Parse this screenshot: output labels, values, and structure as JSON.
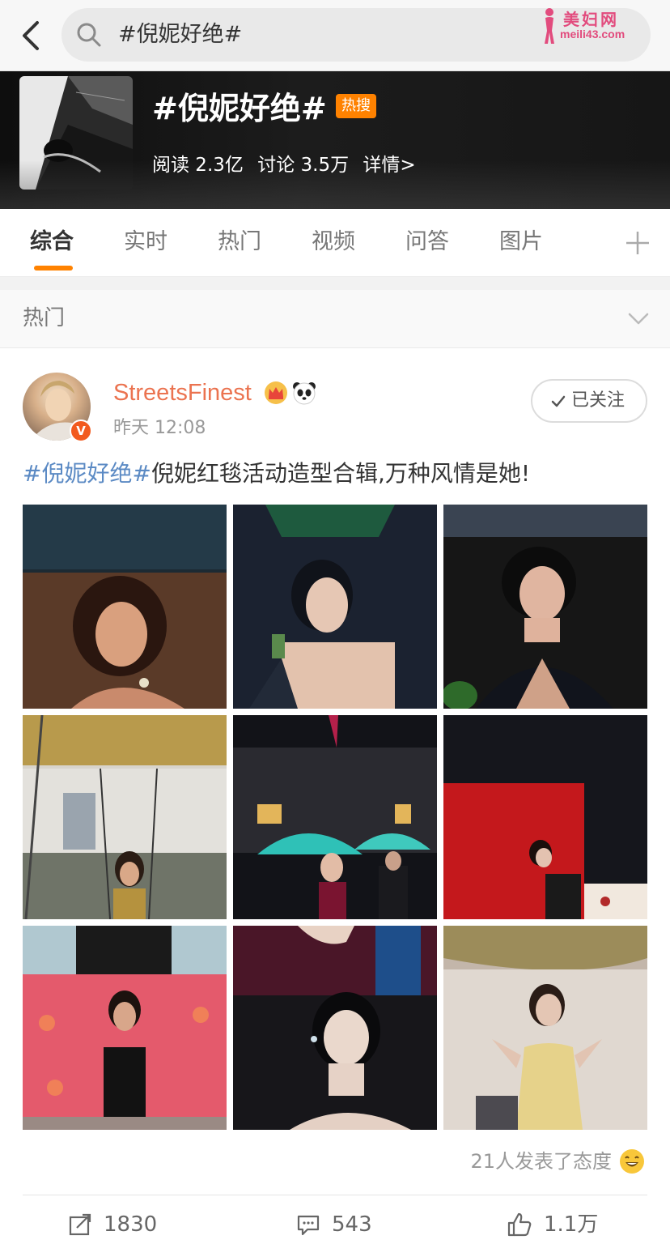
{
  "search": {
    "query": "#倪妮好绝#"
  },
  "watermark": {
    "title": "美妇网",
    "url": "meili43.com"
  },
  "topic": {
    "title": "#倪妮好绝#",
    "badge": "热搜",
    "reads": "阅读 2.3亿",
    "discussions": "讨论 3.5万",
    "details": "详情>"
  },
  "tabs": [
    {
      "label": "综合",
      "active": true
    },
    {
      "label": "实时"
    },
    {
      "label": "热门"
    },
    {
      "label": "视频"
    },
    {
      "label": "问答"
    },
    {
      "label": "图片"
    }
  ],
  "section": {
    "label": "热门"
  },
  "post": {
    "username": "StreetsFinest",
    "verified_mark": "V",
    "time": "昨天 12:08",
    "follow_label": "已关注",
    "hashtag": "#倪妮好绝#",
    "text": "倪妮红毯活动造型合辑,万种风情是她!",
    "reaction_text": "21人发表了态度",
    "reposts": "1830",
    "comments": "543",
    "likes": "1.1万"
  },
  "colors": {
    "accent": "#ff8200",
    "username": "#eb7350",
    "hashtag": "#5b8ac4"
  }
}
